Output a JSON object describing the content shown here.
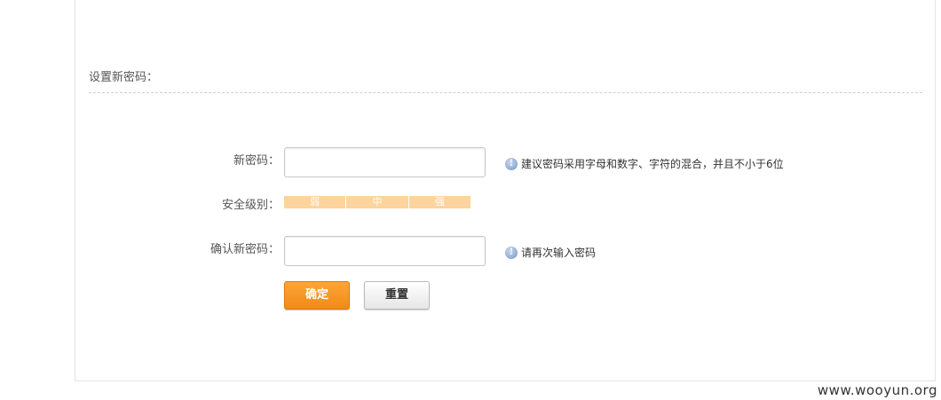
{
  "section": {
    "title": "设置新密码："
  },
  "form": {
    "new_password": {
      "label": "新密码：",
      "value": "",
      "placeholder": "",
      "hint": "建议密码采用字母和数字、字符的混合，并且不小于6位"
    },
    "strength": {
      "label": "安全级别：",
      "levels": [
        "弱",
        "中",
        "强"
      ]
    },
    "confirm_password": {
      "label": "确认新密码：",
      "value": "",
      "placeholder": "",
      "hint": "请再次输入密码"
    },
    "buttons": {
      "confirm_label": "确定",
      "reset_label": "重置"
    }
  },
  "icons": {
    "hint_icon": "info-icon",
    "hint_glyph": "!"
  },
  "colors": {
    "accent": "#f28a14",
    "strength_bar": "#fcd49c"
  },
  "watermark": "www.wooyun.org"
}
